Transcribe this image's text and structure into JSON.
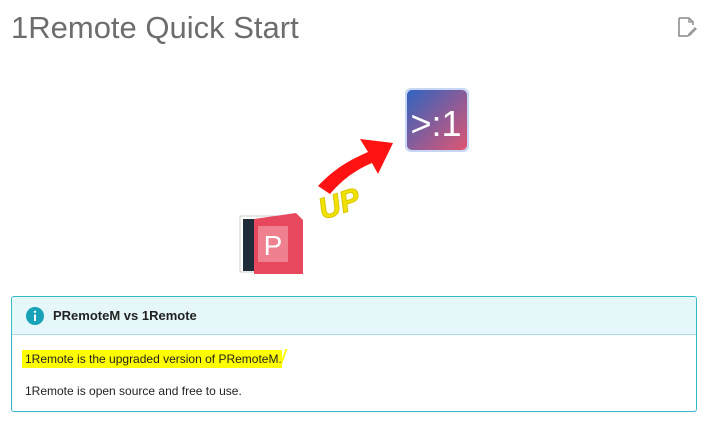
{
  "page": {
    "title": "1Remote Quick Start",
    "edit_icon": "edit-document-icon"
  },
  "art": {
    "new_logo_text": ">:1",
    "old_logo_letter": "P",
    "up_label": "UP",
    "new_logo_colors": [
      "#2f64c0",
      "#e05572"
    ],
    "old_logo_color": "#e8485d",
    "arrow_color": "#ff1212",
    "up_color": "#f2e200"
  },
  "callout": {
    "icon": "info-icon",
    "accent": "#34b8cc",
    "title": "PRemoteM vs 1Remote",
    "line1": "1Remote is the upgraded version of PRemoteM.",
    "line2": "1Remote is open source and free to use.",
    "highlight_color": "#ffff00"
  }
}
